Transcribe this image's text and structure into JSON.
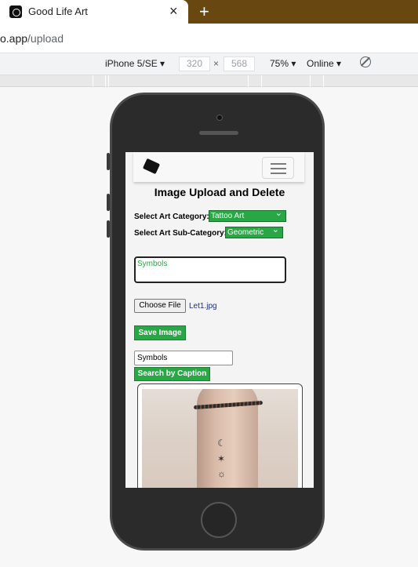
{
  "browser": {
    "tab_title": "Good Life Art",
    "url_prefix": "o.app",
    "url_path": "/upload"
  },
  "device_toolbar": {
    "device": "iPhone 5/SE ▾",
    "width": "320",
    "height": "568",
    "times": "×",
    "zoom": "75% ▾",
    "network": "Online ▾"
  },
  "page": {
    "heading": "Image Upload and Delete",
    "category_label": "Select Art Category:",
    "category_value": "Tattoo Art",
    "subcategory_label": "Select Art Sub-Category:",
    "subcategory_value": "Geometric",
    "caption_value": "Symbols",
    "choose_file_label": "Choose File",
    "file_name": "Let1.jpg",
    "save_button": "Save Image",
    "search_value": "Symbols",
    "search_button": "Search by Caption"
  },
  "icons": {
    "tab_close": "×",
    "new_tab": "+",
    "tattoo_moon": "☾",
    "tattoo_star": "✶",
    "tattoo_sun": "☼"
  },
  "colors": {
    "accent_green": "#28a745",
    "tab_strip": "#694711"
  }
}
